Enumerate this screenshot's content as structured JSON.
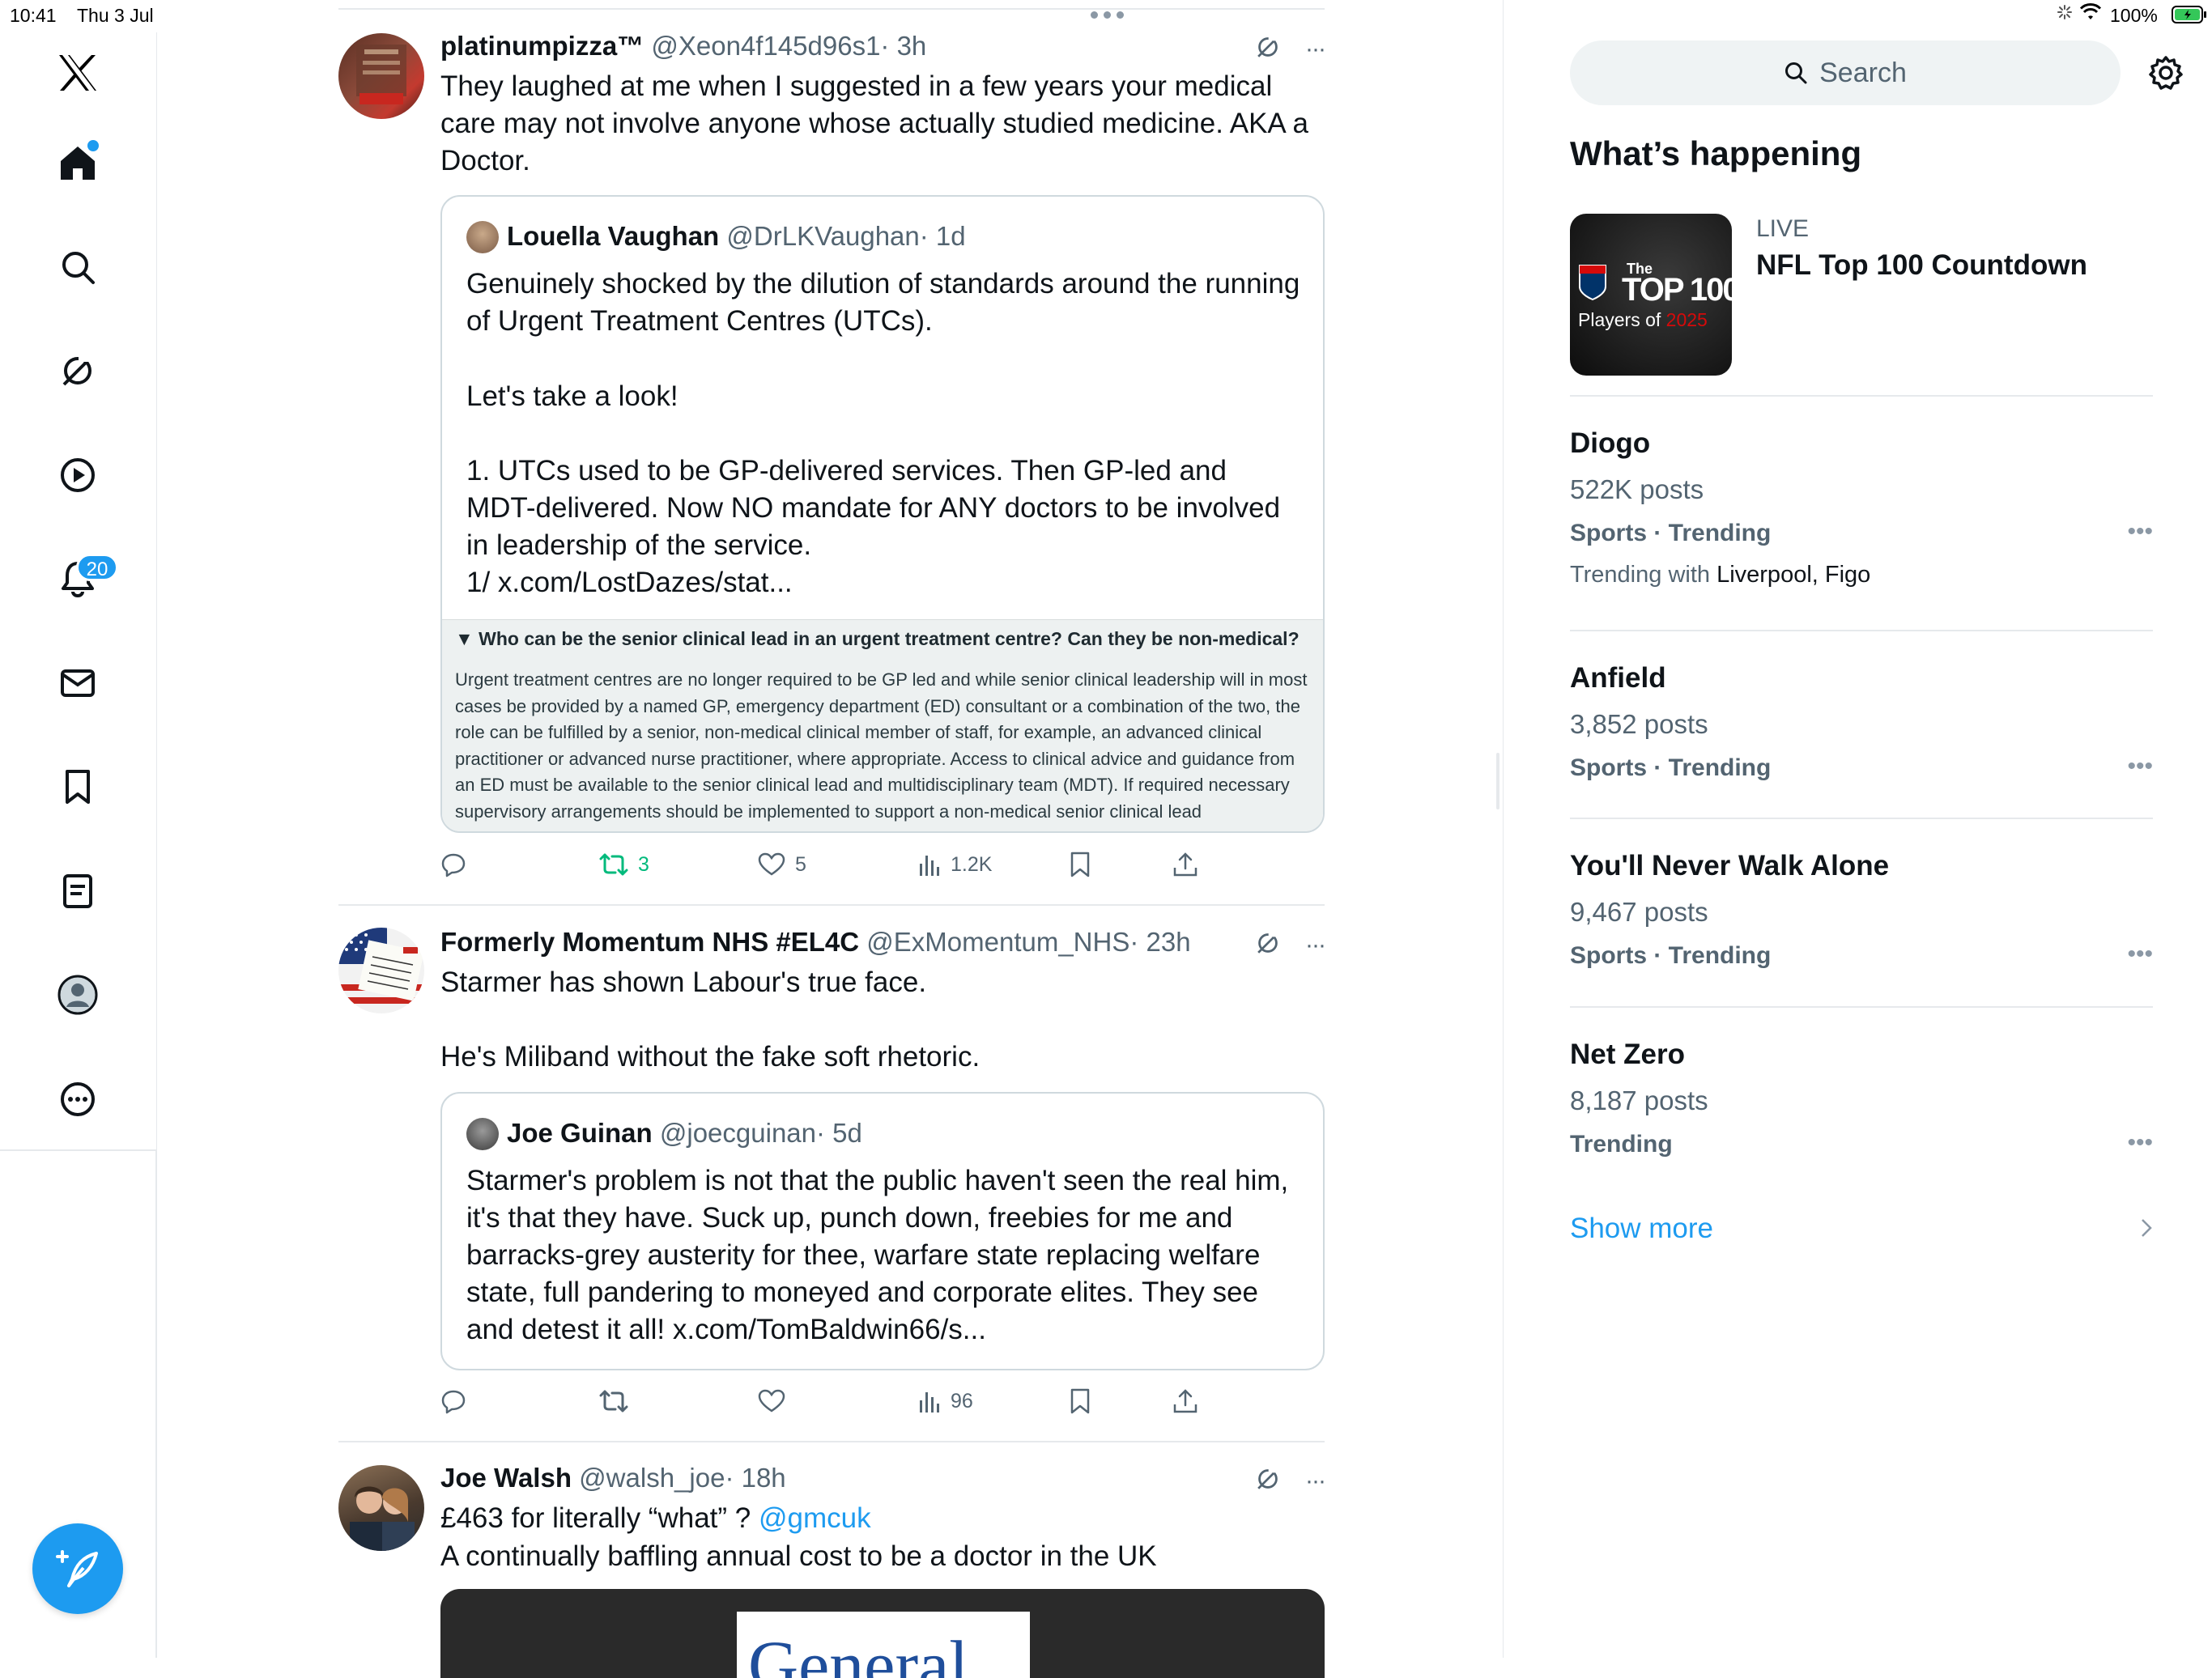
{
  "status_bar": {
    "time": "10:41",
    "date": "Thu 3 Jul",
    "battery": "100%"
  },
  "sidebar": {
    "items": [
      "home",
      "explore",
      "grok",
      "video",
      "notifications",
      "messages",
      "bookmarks",
      "lists",
      "profile",
      "more"
    ],
    "notification_count": "20"
  },
  "feed": {
    "tweets": [
      {
        "name": "platinumpizza™",
        "handle": "@Xeon4f145d96s1",
        "time": "· 3h",
        "text": "They laughed at me when I suggested in a few years your medical care may not involve anyone whose actually studied medicine. AKA a Doctor.",
        "quote": {
          "name": "Louella Vaughan",
          "handle": "@DrLKVaughan",
          "time": "· 1d",
          "p1": "Genuinely shocked by the dilution of standards around the running of Urgent Treatment Centres (UTCs).",
          "p2": "Let's take a look!",
          "p3": "1. UTCs used to be GP-delivered services. Then GP-led and MDT-delivered. Now NO mandate for ANY doctors to be involved in leadership of the service.",
          "p4": "1/ x.com/LostDazes/stat...",
          "image_title": "▼  Who can be the senior clinical lead in an urgent treatment centre? Can they be non-medical?",
          "image_body": "Urgent treatment centres are no longer required to be GP led and while senior clinical leadership will in most cases be provided by a named GP, emergency department (ED) consultant or a combination of the two, the role can be fulfilled by a senior, non-medical clinical member of staff, for example, an advanced clinical practitioner or advanced nurse practitioner, where appropriate. Access to clinical advice and guidance from an ED must be available to the senior clinical lead and multidisciplinary team (MDT). If required necessary supervisory arrangements should be implemented to support a non-medical senior clinical lead"
        },
        "retweets": "3",
        "likes": "5",
        "views": "1.2K"
      },
      {
        "name": "Formerly Momentum NHS #EL4C",
        "handle": "@ExMomentum_NHS",
        "time": "· 23h",
        "p1": "Starmer has shown Labour's true face.",
        "p2": "He's Miliband without the fake soft rhetoric.",
        "quote": {
          "name": "Joe Guinan",
          "handle": "@joecguinan",
          "time": "· 5d",
          "text": "Starmer's problem is not that the public haven't seen the real him, it's that they have. Suck up, punch down, freebies for me and barracks-grey austerity for thee, warfare state replacing welfare state, full pandering to moneyed and corporate elites. They see and detest it all! x.com/TomBaldwin66/s..."
        },
        "views": "96"
      },
      {
        "name": "Joe Walsh",
        "handle": "@walsh_joe",
        "time": "· 18h",
        "line1": "£463 for literally “what” ?",
        "mention": "@gmcuk",
        "line2": "A continually baffling annual cost to be a doctor in the UK",
        "image_text": "General"
      }
    ]
  },
  "right": {
    "search_label": "Search",
    "heading": "What’s happening",
    "live": {
      "tag": "LIVE",
      "title": "NFL Top 100 Countdown",
      "thumb_line1": "The",
      "thumb_line2": "TOP 100",
      "thumb_line3a": "Players of ",
      "thumb_line3b": "2025"
    },
    "trends": [
      {
        "title": "Diogo",
        "posts": "522K posts",
        "category": "Sports · Trending",
        "with_label": "Trending with ",
        "with_value": "Liverpool, Figo"
      },
      {
        "title": "Anfield",
        "posts": "3,852 posts",
        "category": "Sports · Trending"
      },
      {
        "title": "You'll Never Walk Alone",
        "posts": "9,467 posts",
        "category": "Sports · Trending"
      },
      {
        "title": "Net Zero",
        "posts": "8,187 posts",
        "category": "Trending"
      }
    ],
    "show_more": "Show more"
  },
  "colors": {
    "accent": "#1d9bf0",
    "retweet_green": "#00ba7c",
    "secondary": "#536471"
  }
}
